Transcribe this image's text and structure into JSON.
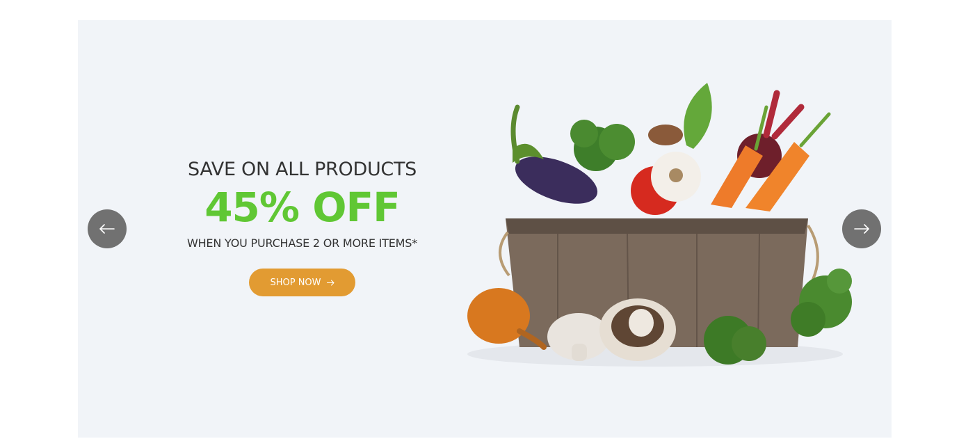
{
  "slide": {
    "subtitle": "SAVE ON ALL PRODUCTS",
    "headline": "45% OFF",
    "description": "WHEN YOU PURCHASE 2 OR MORE ITEMS*",
    "cta_label": "SHOP NOW",
    "cta_icon": "arrow-right-icon",
    "image_alt": "basket of fresh vegetables"
  },
  "navigation": {
    "prev_icon": "arrow-left-icon",
    "next_icon": "arrow-right-icon"
  },
  "colors": {
    "background": "#f1f4f8",
    "headline": "#60c734",
    "cta": "#e29b32",
    "nav_button": "#717171",
    "text": "#333333"
  }
}
